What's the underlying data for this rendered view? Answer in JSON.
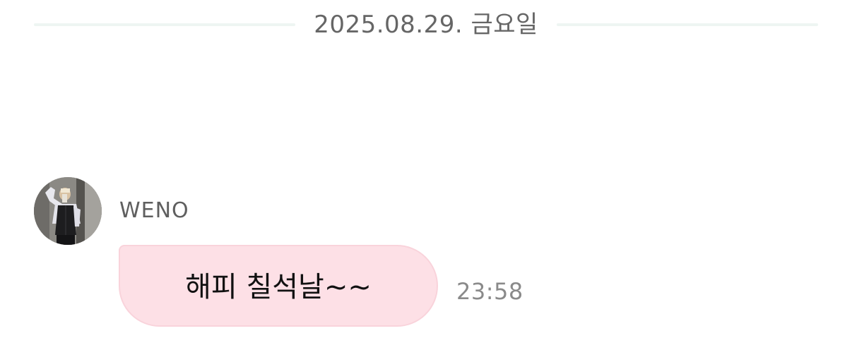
{
  "date_divider": {
    "label": "2025.08.29. 금요일"
  },
  "message": {
    "sender": "WENO",
    "avatar_icon": "profile-photo",
    "text": "해피 칠석날~~",
    "time": "23:58",
    "bubble_color": "#fde0e6"
  }
}
